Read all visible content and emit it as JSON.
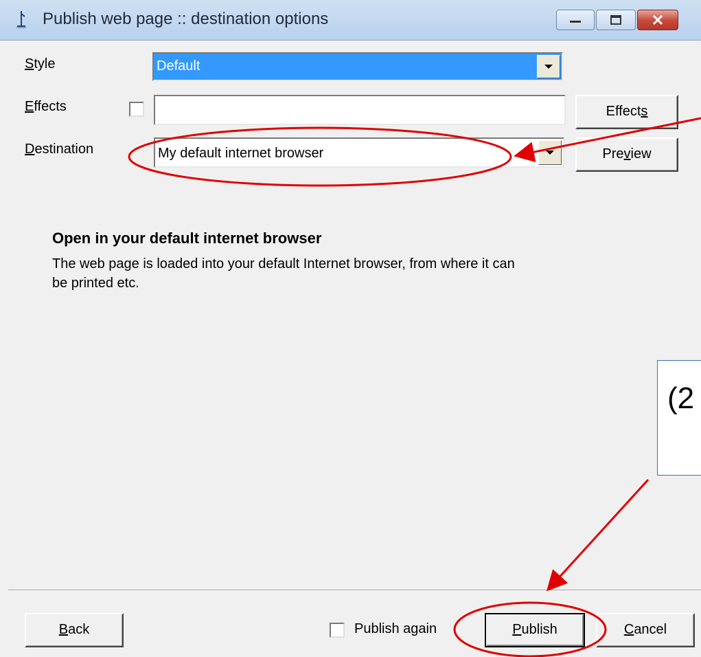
{
  "window": {
    "title": "Publish web page :: destination options",
    "icons": [
      "app-icon",
      "minimize-icon",
      "maximize-icon",
      "close-icon"
    ]
  },
  "style": {
    "label_u": "S",
    "label_rest": "tyle",
    "value": "Default"
  },
  "effects": {
    "label_u": "E",
    "label_rest": "ffects",
    "value": "",
    "button_pre": "Effect",
    "button_u": "s",
    "button_post": ""
  },
  "destination": {
    "label_u": "D",
    "label_rest": "estination",
    "value": "My default internet browser",
    "button_pre": "Pre",
    "button_u": "v",
    "button_post": "iew"
  },
  "info": {
    "heading": "Open in your default internet browser",
    "description": "The web page is loaded into your default Internet browser, from where it can be printed etc."
  },
  "footer": {
    "back_u": "B",
    "back_rest": "ack",
    "publish_again": "Publish again",
    "publish_u": "P",
    "publish_rest": "ublish",
    "cancel_u": "C",
    "cancel_rest": "ancel"
  },
  "callout": {
    "text": "(2"
  },
  "colors": {
    "annotation": "#e00000",
    "selection": "#3399ff",
    "callout_border": "#3b6fc0"
  }
}
